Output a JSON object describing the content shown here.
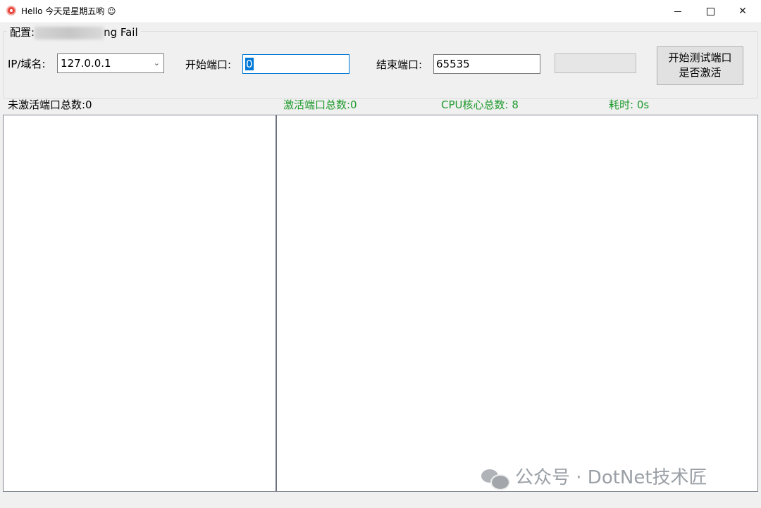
{
  "window": {
    "title": "Hello 今天是星期五哟 ☺",
    "minimize_label": "",
    "maximize_label": "",
    "close_label": "✕"
  },
  "group": {
    "legend_prefix": "配置:",
    "legend_suffix": "ng Fail"
  },
  "form": {
    "ip_label": "IP/域名:",
    "ip_value": "127.0.0.1",
    "start_label": "开始端口:",
    "start_value": "0",
    "end_label": "结束端口:",
    "end_value": "65535",
    "progress_fraction": 0,
    "start_button_line1": "开始测试端口",
    "start_button_line2": "是否激活"
  },
  "stats": {
    "inactive": "未激活端口总数:0",
    "active": "激活端口总数:0",
    "cpu": "CPU核心总数:  8",
    "elapsed": "耗时:  0s"
  },
  "watermark": {
    "text": "公众号 · DotNet技术匠"
  },
  "colors": {
    "accent": "#0078d7",
    "stat_green": "#1e9a2c"
  }
}
